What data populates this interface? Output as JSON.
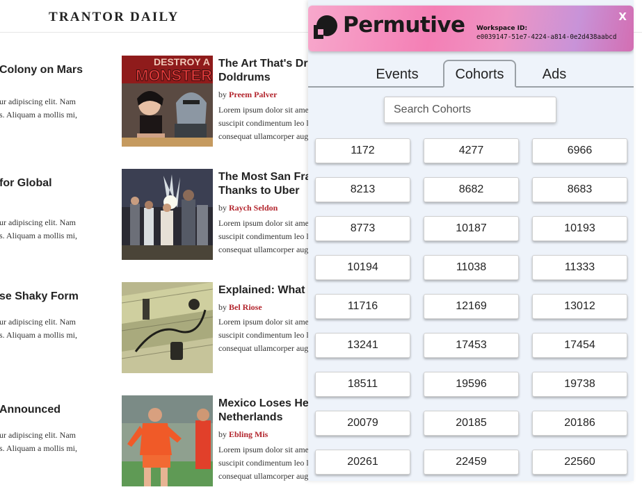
{
  "site": {
    "title": "TRANTOR DAILY"
  },
  "left_articles": [
    {
      "title": "Colony on Mars",
      "excerpt_1": "ur adipiscing elit. Nam",
      "excerpt_2": "s. Aliquam a mollis mi,"
    },
    {
      "title": "for Global",
      "excerpt_1": "ur adipiscing elit. Nam",
      "excerpt_2": "s. Aliquam a mollis mi,"
    },
    {
      "title": "se Shaky Form",
      "excerpt_1": "ur adipiscing elit. Nam",
      "excerpt_2": "s. Aliquam a mollis mi,"
    },
    {
      "title": "Announced",
      "excerpt_1": "ur adipiscing elit. Nam",
      "excerpt_2": "s. Aliquam a mollis mi,"
    }
  ],
  "articles": [
    {
      "title_1": "The Art That's Dr",
      "title_2": "Doldrums",
      "by": "by",
      "author": "Preem Palver",
      "excerpt_1": "Lorem ipsum dolor sit amet",
      "excerpt_2": "suscipit condimentum leo l",
      "excerpt_3": "consequat ullamcorper aug",
      "image_text_1": "DESTROY A",
      "image_text_2": "MONSTER"
    },
    {
      "title_1": "The Most San Fra",
      "title_2": "Thanks to Uber",
      "by": "by",
      "author": "Raych Seldon",
      "excerpt_1": "Lorem ipsum dolor sit amet",
      "excerpt_2": "suscipit condimentum leo l",
      "excerpt_3": "consequat ullamcorper aug"
    },
    {
      "title_1": "Explained: What",
      "title_2": "",
      "by": "by",
      "author": "Bel Riose",
      "excerpt_1": "Lorem ipsum dolor sit amet",
      "excerpt_2": "suscipit condimentum leo l",
      "excerpt_3": "consequat ullamcorper aug"
    },
    {
      "title_1": "Mexico Loses He",
      "title_2": "Netherlands",
      "by": "by",
      "author": "Ebling Mis",
      "excerpt_1": "Lorem ipsum dolor sit amet",
      "excerpt_2": "suscipit condimentum leo l",
      "excerpt_3": "consequat ullamcorper aug"
    }
  ],
  "panel": {
    "brand": "Permutive",
    "workspace_label": "Workspace ID:",
    "workspace_id": "e0039147-51e7-4224-a814-0e2d438aabcd",
    "close_label": "X",
    "tabs": [
      "Events",
      "Cohorts",
      "Ads"
    ],
    "active_tab": "Cohorts",
    "search_placeholder": "Search Cohorts",
    "cohorts": [
      "1172",
      "4277",
      "6966",
      "8213",
      "8682",
      "8683",
      "8773",
      "10187",
      "10193",
      "10194",
      "11038",
      "11333",
      "11716",
      "12169",
      "13012",
      "13241",
      "17453",
      "17454",
      "18511",
      "19596",
      "19738",
      "20079",
      "20185",
      "20186",
      "20261",
      "22459",
      "22560"
    ]
  },
  "colors": {
    "author_red": "#b3262e",
    "panel_bg": "#eef3fa",
    "header_pink": "#f47fb5",
    "header_purple": "#c893d8"
  }
}
